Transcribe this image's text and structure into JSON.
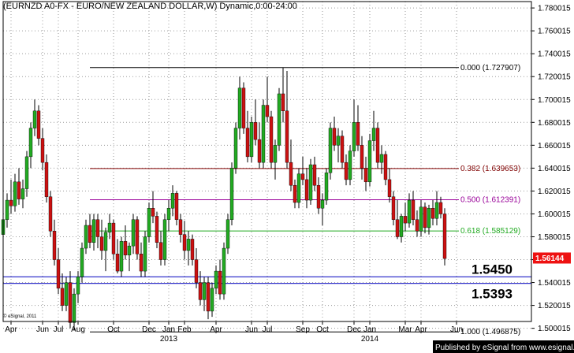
{
  "header": {
    "title": "(EURNZD A0-FX - EURO/NEW ZEALAND DOLLAR,W) Dynamic,0:00-24:00"
  },
  "copyright": "© eSignal, 2011",
  "publisher": "Published by eSignal from www.esignal.com",
  "colors": {
    "up_candle": "#22aa22",
    "down_candle": "#cc1111",
    "fib_0": "#000000",
    "fib_382": "#800000",
    "fib_500": "#990099",
    "fib_618": "#22aa22",
    "fib_100": "#000000",
    "support": "#3333cc",
    "last_price_bg": "#ee1111",
    "footer_bg": "#000000"
  },
  "chart_data": {
    "type": "candlestick",
    "timeframe": "weekly",
    "ylim": [
      1.49,
      1.79
    ],
    "y_ticks": [
      "1.500015",
      "1.520015",
      "1.540015",
      "1.560015",
      "1.580015",
      "1.600015",
      "1.620015",
      "1.640015",
      "1.660015",
      "1.680015",
      "1.700015",
      "1.720015",
      "1.740015",
      "1.760015",
      "1.780015"
    ],
    "x_ticks": [
      {
        "label": "Apr",
        "week": 2
      },
      {
        "label": "Jun",
        "week": 10
      },
      {
        "label": "Jul",
        "week": 14
      },
      {
        "label": "Aug",
        "week": 19
      },
      {
        "label": "Oct",
        "week": 28
      },
      {
        "label": "Dec",
        "week": 37
      },
      {
        "label": "Jan",
        "week": 42
      },
      {
        "label": "Feb",
        "week": 46
      },
      {
        "label": "Apr",
        "week": 54
      },
      {
        "label": "Jun",
        "week": 63
      },
      {
        "label": "Jul",
        "week": 67
      },
      {
        "label": "Sep",
        "week": 76
      },
      {
        "label": "Oct",
        "week": 81
      },
      {
        "label": "Dec",
        "week": 89
      },
      {
        "label": "Jan",
        "week": 93
      },
      {
        "label": "Mar",
        "week": 102
      },
      {
        "label": "Apr",
        "week": 106
      },
      {
        "label": "Jun",
        "week": 115
      }
    ],
    "year_labels": [
      {
        "label": "2013",
        "week": 42
      },
      {
        "label": "2014",
        "week": 93
      }
    ],
    "fib_levels": [
      {
        "label": "0.000 (1.727907)",
        "value": 1.727907,
        "start_week": 22,
        "color_key": "fib_0"
      },
      {
        "label": "0.382 (1.639653)",
        "value": 1.639653,
        "start_week": 22,
        "color_key": "fib_382"
      },
      {
        "label": "0.500 (1.612391)",
        "value": 1.612391,
        "start_week": 22,
        "color_key": "fib_500"
      },
      {
        "label": "0.618 (1.585129)",
        "value": 1.585129,
        "start_week": 22,
        "color_key": "fib_618"
      },
      {
        "label": "1.000 (1.496875)",
        "value": 1.496875,
        "start_week": 22,
        "color_key": "fib_100"
      }
    ],
    "support_levels": [
      {
        "label": "1.5450",
        "value": 1.545
      },
      {
        "label": "1.5393",
        "value": 1.5393
      }
    ],
    "last_price": {
      "label": "1.56144",
      "value": 1.56144
    },
    "ohlc": [
      [
        1.582,
        1.6,
        1.57,
        1.595
      ],
      [
        1.595,
        1.618,
        1.588,
        1.612
      ],
      [
        1.612,
        1.63,
        1.6,
        1.607
      ],
      [
        1.607,
        1.635,
        1.602,
        1.628
      ],
      [
        1.628,
        1.64,
        1.608,
        1.613
      ],
      [
        1.613,
        1.63,
        1.605,
        1.622
      ],
      [
        1.622,
        1.655,
        1.615,
        1.65
      ],
      [
        1.65,
        1.68,
        1.64,
        1.675
      ],
      [
        1.675,
        1.7,
        1.668,
        1.69
      ],
      [
        1.69,
        1.695,
        1.66,
        1.666
      ],
      [
        1.666,
        1.675,
        1.638,
        1.645
      ],
      [
        1.645,
        1.652,
        1.61,
        1.615
      ],
      [
        1.615,
        1.62,
        1.58,
        1.585
      ],
      [
        1.585,
        1.595,
        1.555,
        1.56
      ],
      [
        1.56,
        1.57,
        1.53,
        1.535
      ],
      [
        1.535,
        1.548,
        1.515,
        1.52
      ],
      [
        1.52,
        1.545,
        1.515,
        1.54
      ],
      [
        1.54,
        1.55,
        1.5,
        1.505
      ],
      [
        1.505,
        1.535,
        1.498,
        1.53
      ],
      [
        1.53,
        1.55,
        1.522,
        1.545
      ],
      [
        1.545,
        1.575,
        1.54,
        1.57
      ],
      [
        1.57,
        1.595,
        1.565,
        1.59
      ],
      [
        1.59,
        1.6,
        1.57,
        1.575
      ],
      [
        1.575,
        1.6,
        1.568,
        1.595
      ],
      [
        1.595,
        1.6,
        1.57,
        1.58
      ],
      [
        1.58,
        1.595,
        1.56,
        1.568
      ],
      [
        1.568,
        1.588,
        1.55,
        1.584
      ],
      [
        1.584,
        1.6,
        1.578,
        1.592
      ],
      [
        1.592,
        1.595,
        1.56,
        1.565
      ],
      [
        1.565,
        1.578,
        1.548,
        1.55
      ],
      [
        1.55,
        1.58,
        1.545,
        1.576
      ],
      [
        1.576,
        1.59,
        1.56,
        1.564
      ],
      [
        1.564,
        1.575,
        1.55,
        1.572
      ],
      [
        1.572,
        1.6,
        1.565,
        1.595
      ],
      [
        1.595,
        1.598,
        1.56,
        1.565
      ],
      [
        1.565,
        1.575,
        1.545,
        1.55
      ],
      [
        1.55,
        1.585,
        1.545,
        1.58
      ],
      [
        1.58,
        1.61,
        1.575,
        1.605
      ],
      [
        1.605,
        1.62,
        1.592,
        1.598
      ],
      [
        1.598,
        1.602,
        1.57,
        1.575
      ],
      [
        1.575,
        1.585,
        1.555,
        1.56
      ],
      [
        1.56,
        1.6,
        1.555,
        1.595
      ],
      [
        1.595,
        1.612,
        1.585,
        1.605
      ],
      [
        1.605,
        1.625,
        1.598,
        1.618
      ],
      [
        1.618,
        1.62,
        1.59,
        1.595
      ],
      [
        1.595,
        1.6,
        1.575,
        1.582
      ],
      [
        1.582,
        1.594,
        1.56,
        1.568
      ],
      [
        1.568,
        1.585,
        1.555,
        1.578
      ],
      [
        1.578,
        1.582,
        1.555,
        1.56
      ],
      [
        1.56,
        1.57,
        1.535,
        1.54
      ],
      [
        1.54,
        1.55,
        1.52,
        1.525
      ],
      [
        1.525,
        1.545,
        1.515,
        1.54
      ],
      [
        1.54,
        1.545,
        1.508,
        1.515
      ],
      [
        1.515,
        1.54,
        1.51,
        1.535
      ],
      [
        1.535,
        1.555,
        1.53,
        1.55
      ],
      [
        1.55,
        1.56,
        1.525,
        1.53
      ],
      [
        1.53,
        1.575,
        1.525,
        1.57
      ],
      [
        1.57,
        1.6,
        1.565,
        1.595
      ],
      [
        1.595,
        1.645,
        1.59,
        1.64
      ],
      [
        1.64,
        1.68,
        1.635,
        1.675
      ],
      [
        1.675,
        1.72,
        1.665,
        1.71
      ],
      [
        1.71,
        1.715,
        1.67,
        1.675
      ],
      [
        1.675,
        1.69,
        1.645,
        1.65
      ],
      [
        1.65,
        1.685,
        1.645,
        1.68
      ],
      [
        1.68,
        1.7,
        1.66,
        1.665
      ],
      [
        1.665,
        1.68,
        1.64,
        1.645
      ],
      [
        1.645,
        1.7,
        1.64,
        1.695
      ],
      [
        1.695,
        1.72,
        1.68,
        1.685
      ],
      [
        1.685,
        1.69,
        1.64,
        1.645
      ],
      [
        1.645,
        1.665,
        1.63,
        1.66
      ],
      [
        1.66,
        1.71,
        1.655,
        1.705
      ],
      [
        1.705,
        1.728,
        1.68,
        1.69
      ],
      [
        1.69,
        1.725,
        1.64,
        1.645
      ],
      [
        1.645,
        1.665,
        1.62,
        1.625
      ],
      [
        1.625,
        1.63,
        1.605,
        1.61
      ],
      [
        1.61,
        1.64,
        1.605,
        1.635
      ],
      [
        1.635,
        1.65,
        1.625,
        1.63
      ],
      [
        1.63,
        1.64,
        1.605,
        1.612
      ],
      [
        1.612,
        1.648,
        1.608,
        1.643
      ],
      [
        1.643,
        1.65,
        1.62,
        1.625
      ],
      [
        1.625,
        1.632,
        1.6,
        1.605
      ],
      [
        1.605,
        1.618,
        1.59,
        1.612
      ],
      [
        1.612,
        1.64,
        1.608,
        1.636
      ],
      [
        1.636,
        1.68,
        1.63,
        1.675
      ],
      [
        1.675,
        1.685,
        1.655,
        1.66
      ],
      [
        1.66,
        1.675,
        1.645,
        1.668
      ],
      [
        1.668,
        1.673,
        1.64,
        1.645
      ],
      [
        1.645,
        1.652,
        1.625,
        1.63
      ],
      [
        1.63,
        1.66,
        1.625,
        1.655
      ],
      [
        1.655,
        1.7,
        1.65,
        1.68
      ],
      [
        1.68,
        1.695,
        1.655,
        1.66
      ],
      [
        1.66,
        1.668,
        1.63,
        1.64
      ],
      [
        1.64,
        1.65,
        1.62,
        1.628
      ],
      [
        1.628,
        1.67,
        1.624,
        1.664
      ],
      [
        1.664,
        1.69,
        1.655,
        1.675
      ],
      [
        1.675,
        1.68,
        1.64,
        1.645
      ],
      [
        1.645,
        1.66,
        1.635,
        1.652
      ],
      [
        1.652,
        1.655,
        1.625,
        1.63
      ],
      [
        1.63,
        1.64,
        1.61,
        1.615
      ],
      [
        1.615,
        1.62,
        1.59,
        1.595
      ],
      [
        1.595,
        1.612,
        1.578,
        1.58
      ],
      [
        1.58,
        1.6,
        1.575,
        1.598
      ],
      [
        1.598,
        1.61,
        1.585,
        1.592
      ],
      [
        1.592,
        1.618,
        1.588,
        1.612
      ],
      [
        1.612,
        1.62,
        1.59,
        1.595
      ],
      [
        1.595,
        1.603,
        1.58,
        1.585
      ],
      [
        1.585,
        1.612,
        1.58,
        1.606
      ],
      [
        1.606,
        1.61,
        1.583,
        1.588
      ],
      [
        1.588,
        1.608,
        1.582,
        1.605
      ],
      [
        1.605,
        1.612,
        1.59,
        1.596
      ],
      [
        1.596,
        1.62,
        1.59,
        1.61
      ],
      [
        1.61,
        1.615,
        1.596,
        1.6
      ],
      [
        1.6,
        1.605,
        1.555,
        1.561
      ]
    ]
  }
}
